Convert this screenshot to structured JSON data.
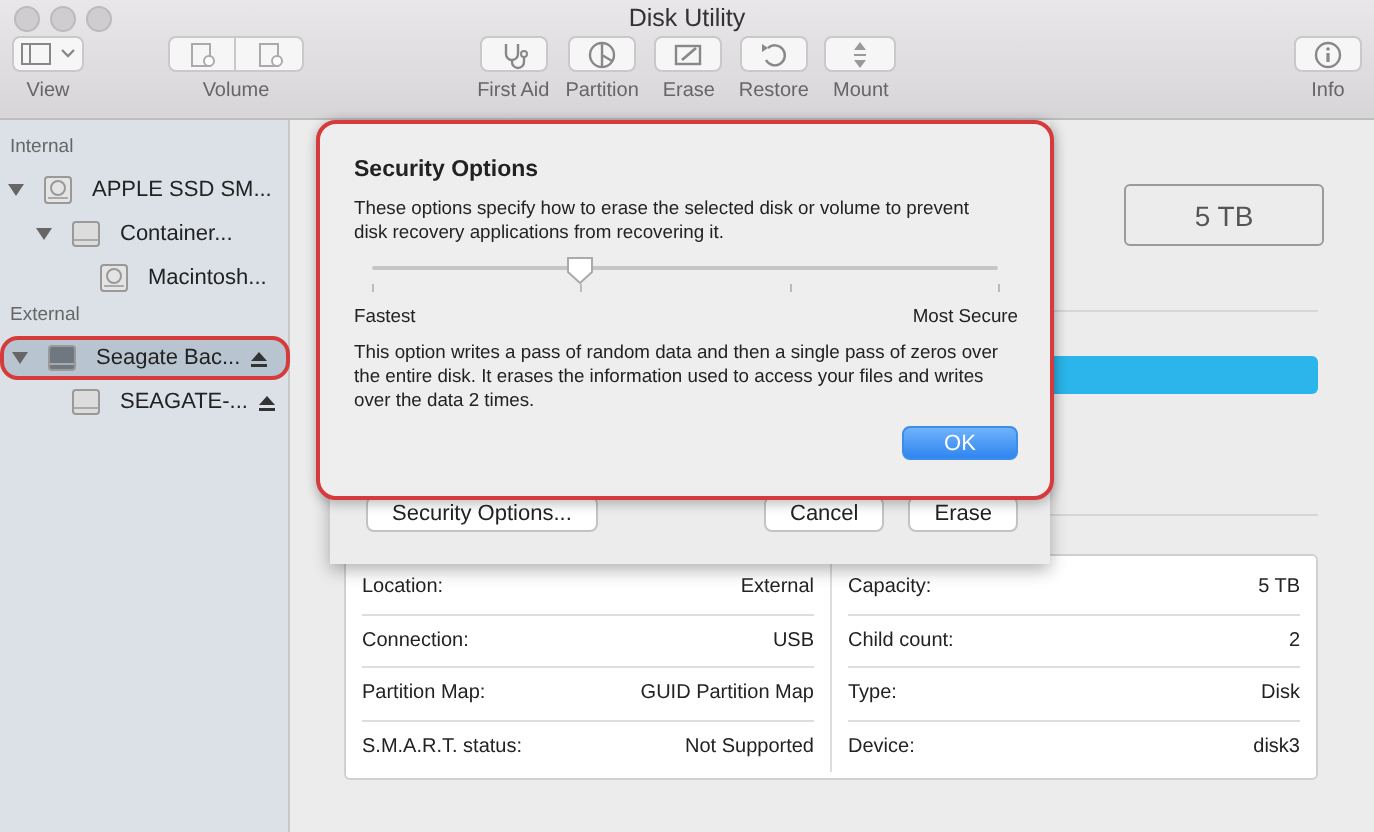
{
  "window": {
    "title": "Disk Utility"
  },
  "toolbar": {
    "left": [
      {
        "kind": "view",
        "label": "View"
      },
      {
        "kind": "volume",
        "label": "Volume"
      }
    ],
    "center": [
      {
        "kind": "first-aid",
        "label": "First Aid"
      },
      {
        "kind": "partition",
        "label": "Partition"
      },
      {
        "kind": "erase",
        "label": "Erase"
      },
      {
        "kind": "restore",
        "label": "Restore"
      },
      {
        "kind": "mount",
        "label": "Mount"
      }
    ],
    "right": [
      {
        "kind": "info",
        "label": "Info"
      }
    ]
  },
  "sidebar": {
    "sections": [
      {
        "label": "Internal",
        "items": [
          {
            "label": "APPLE SSD SM...",
            "kind": "hdd",
            "expanded": true,
            "selected": false,
            "ejectable": false,
            "children": [
              {
                "label": "Container...",
                "kind": "plain",
                "expanded": true,
                "selected": false,
                "ejectable": false,
                "children": [
                  {
                    "label": "Macintosh...",
                    "kind": "hdd",
                    "selected": false,
                    "ejectable": false
                  }
                ]
              }
            ]
          }
        ]
      },
      {
        "label": "External",
        "items": [
          {
            "label": "Seagate Bac...",
            "kind": "plain",
            "expanded": true,
            "selected": true,
            "ejectable": true,
            "children": [
              {
                "label": "SEAGATE-...",
                "kind": "plain",
                "selected": false,
                "ejectable": true
              }
            ]
          }
        ]
      }
    ]
  },
  "capacity_box": "5 TB",
  "erase_sheet": {
    "buttons": [
      {
        "kind": "left",
        "label": "Security Options..."
      },
      {
        "kind": "right",
        "label": "Cancel"
      },
      {
        "kind": "right",
        "label": "Erase"
      }
    ]
  },
  "security_options": {
    "title": "Security Options",
    "description": "These options specify how to erase the selected disk or volume to prevent disk recovery applications from recovering it.",
    "slider": {
      "level": 0.333,
      "min_label": "Fastest",
      "max_label": "Most Secure"
    },
    "detail": "This option writes a pass of random data and then a single pass of zeros over the entire disk. It erases the information used to access your files and writes over the data 2 times.",
    "ok_button": "OK"
  },
  "info": {
    "columns": [
      [
        {
          "label": "Location:",
          "value": "External"
        },
        {
          "label": "Connection:",
          "value": "USB"
        },
        {
          "label": "Partition Map:",
          "value": "GUID Partition Map"
        },
        {
          "label": "S.M.A.R.T. status:",
          "value": "Not Supported"
        }
      ],
      [
        {
          "label": "Capacity:",
          "value": "5 TB"
        },
        {
          "label": "Child count:",
          "value": "2"
        },
        {
          "label": "Type:",
          "value": "Disk"
        },
        {
          "label": "Device:",
          "value": "disk3"
        }
      ]
    ]
  }
}
